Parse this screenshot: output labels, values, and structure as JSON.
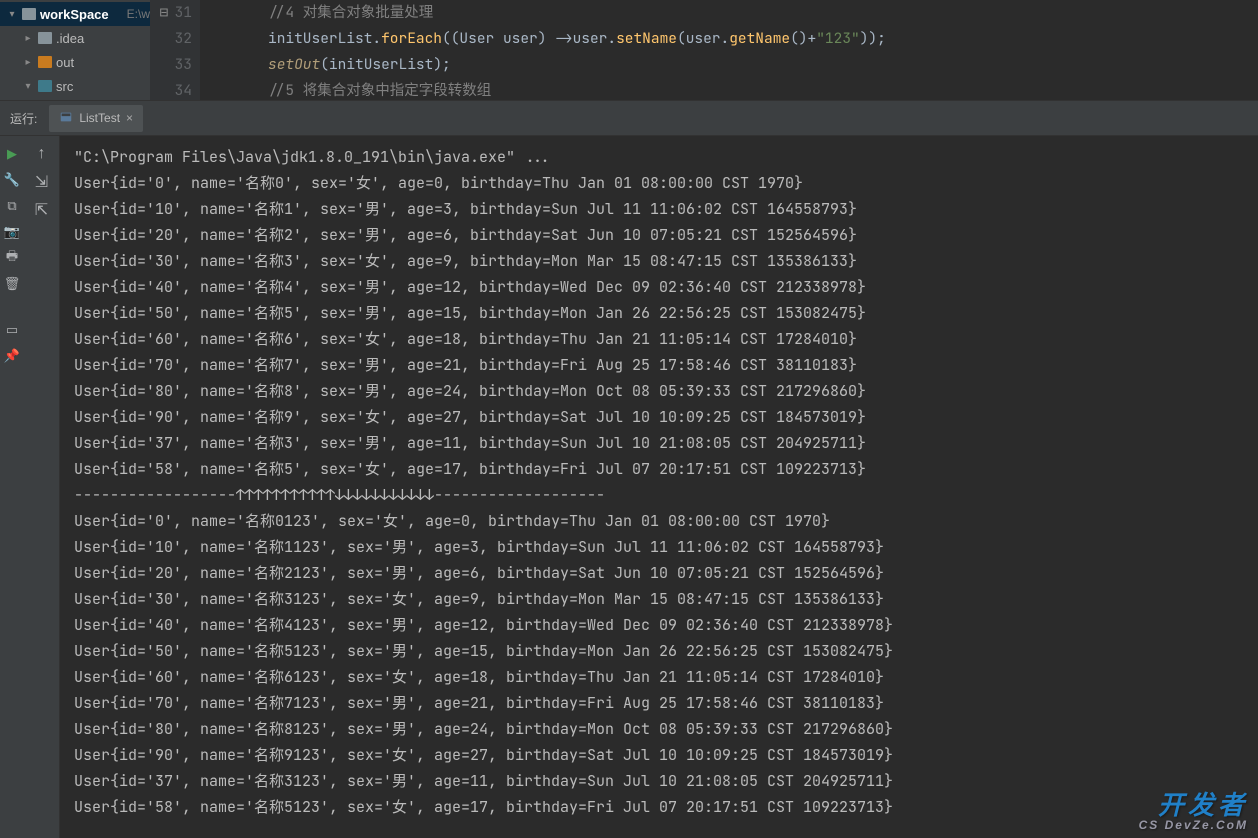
{
  "projectTree": {
    "root": {
      "name": "workSpace",
      "path": "E:\\w"
    },
    "children": [
      {
        "name": ".idea",
        "icon": "gray",
        "expanded": false
      },
      {
        "name": "out",
        "icon": "orange",
        "expanded": false
      },
      {
        "name": "src",
        "icon": "teal",
        "expanded": true
      }
    ]
  },
  "editor": {
    "lines": [
      {
        "num": "31",
        "html": "<span class='c-comment'>//4 对集合对象批量处理</span>"
      },
      {
        "num": "32",
        "html": "<span class='c-id'>initUserList</span>.<span class='c-method'>forEach</span>((<span class='c-type'>User</span> <span class='c-param'>user</span>) -&gt;<span class='c-param'>user</span>.<span class='c-method'>setName</span>(<span class='c-param'>user</span>.<span class='c-method'>getName</span>()+<span class='c-string'>\"123\"</span>));"
      },
      {
        "num": "33",
        "html": "<span class='c-call'>setOut</span>(<span class='c-id'>initUserList</span>);"
      },
      {
        "num": "34",
        "html": "<span class='c-comment'>//5 将集合对象中指定字段转数组</span>"
      }
    ]
  },
  "runLabel": "运行:",
  "tab": {
    "name": "ListTest"
  },
  "console": {
    "header": "\"C:\\Program Files\\Java\\jdk1.8.0_191\\bin\\java.exe\" ...",
    "before": [
      "User{id='0', name='名称0', sex='女', age=0, birthday=Thu Jan 01 08:00:00 CST 1970}",
      "User{id='10', name='名称1', sex='男', age=3, birthday=Sun Jul 11 11:06:02 CST 164558793}",
      "User{id='20', name='名称2', sex='男', age=6, birthday=Sat Jun 10 07:05:21 CST 152564596}",
      "User{id='30', name='名称3', sex='女', age=9, birthday=Mon Mar 15 08:47:15 CST 135386133}",
      "User{id='40', name='名称4', sex='男', age=12, birthday=Wed Dec 09 02:36:40 CST 212338978}",
      "User{id='50', name='名称5', sex='男', age=15, birthday=Mon Jan 26 22:56:25 CST 153082475}",
      "User{id='60', name='名称6', sex='女', age=18, birthday=Thu Jan 21 11:05:14 CST 17284010}",
      "User{id='70', name='名称7', sex='男', age=21, birthday=Fri Aug 25 17:58:46 CST 38110183}",
      "User{id='80', name='名称8', sex='男', age=24, birthday=Mon Oct 08 05:39:33 CST 217296860}",
      "User{id='90', name='名称9', sex='女', age=27, birthday=Sat Jul 10 10:09:25 CST 184573019}",
      "User{id='37', name='名称3', sex='男', age=11, birthday=Sun Jul 10 21:08:05 CST 204925711}",
      "User{id='58', name='名称5', sex='女', age=17, birthday=Fri Jul 07 20:17:51 CST 109223713}"
    ],
    "separator": "------------------↑↑↑↑↑↑↑↑↑↑↑↓↓↓↓↓↓↓↓↓↓↓-------------------",
    "after": [
      "User{id='0', name='名称0123', sex='女', age=0, birthday=Thu Jan 01 08:00:00 CST 1970}",
      "User{id='10', name='名称1123', sex='男', age=3, birthday=Sun Jul 11 11:06:02 CST 164558793}",
      "User{id='20', name='名称2123', sex='男', age=6, birthday=Sat Jun 10 07:05:21 CST 152564596}",
      "User{id='30', name='名称3123', sex='女', age=9, birthday=Mon Mar 15 08:47:15 CST 135386133}",
      "User{id='40', name='名称4123', sex='男', age=12, birthday=Wed Dec 09 02:36:40 CST 212338978}",
      "User{id='50', name='名称5123', sex='男', age=15, birthday=Mon Jan 26 22:56:25 CST 153082475}",
      "User{id='60', name='名称6123', sex='女', age=18, birthday=Thu Jan 21 11:05:14 CST 17284010}",
      "User{id='70', name='名称7123', sex='男', age=21, birthday=Fri Aug 25 17:58:46 CST 38110183}",
      "User{id='80', name='名称8123', sex='男', age=24, birthday=Mon Oct 08 05:39:33 CST 217296860}",
      "User{id='90', name='名称9123', sex='女', age=27, birthday=Sat Jul 10 10:09:25 CST 184573019}",
      "User{id='37', name='名称3123', sex='男', age=11, birthday=Sun Jul 10 21:08:05 CST 204925711}",
      "User{id='58', name='名称5123', sex='女', age=17, birthday=Fri Jul 07 20:17:51 CST 109223713}"
    ]
  },
  "watermark": {
    "main": "开发者",
    "sub": "CS DevZe.CoM"
  }
}
